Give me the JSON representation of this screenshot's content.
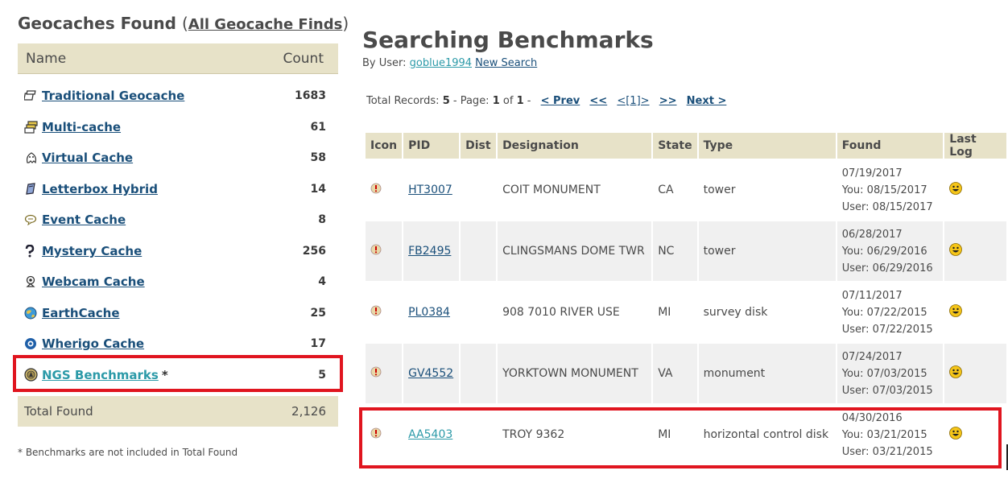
{
  "left": {
    "title": "Geocaches Found",
    "title_link": "All Geocache Finds",
    "header_name": "Name",
    "header_count": "Count",
    "rows": [
      {
        "label": "Traditional Geocache",
        "count": "1683",
        "icon": "traditional-cache-icon"
      },
      {
        "label": "Multi-cache",
        "count": "61",
        "icon": "multi-cache-icon"
      },
      {
        "label": "Virtual Cache",
        "count": "58",
        "icon": "virtual-cache-icon"
      },
      {
        "label": "Letterbox Hybrid",
        "count": "14",
        "icon": "letterbox-icon"
      },
      {
        "label": "Event Cache",
        "count": "8",
        "icon": "event-cache-icon"
      },
      {
        "label": "Mystery Cache",
        "count": "256",
        "icon": "mystery-cache-icon"
      },
      {
        "label": "Webcam Cache",
        "count": "4",
        "icon": "webcam-cache-icon"
      },
      {
        "label": "EarthCache",
        "count": "25",
        "icon": "earthcache-icon"
      },
      {
        "label": "Wherigo Cache",
        "count": "17",
        "icon": "wherigo-cache-icon"
      },
      {
        "label": "NGS Benchmarks",
        "count": "5",
        "icon": "benchmark-icon",
        "suffix": "*"
      }
    ],
    "total_label": "Total Found",
    "total_value": "2,126",
    "footnote": "* Benchmarks are not included in Total Found"
  },
  "right": {
    "title": "Searching Benchmarks",
    "by_user_prefix": "By User:",
    "user": "goblue1994",
    "new_search": "New Search",
    "pager": {
      "total_prefix": "Total Records:",
      "total": "5",
      "page_label": "- Page:",
      "page": "1",
      "of_label": "of",
      "pages": "1",
      "dash": "-",
      "prev": "< Prev",
      "first": "<<",
      "current": "<[1]>",
      "last": ">>",
      "next": "Next >"
    },
    "columns": [
      "Icon",
      "PID",
      "Dist",
      "Designation",
      "State",
      "Type",
      "Found",
      "Last Log"
    ],
    "rows": [
      {
        "pid": "HT3007",
        "dist": "",
        "designation": "COIT MONUMENT",
        "state": "CA",
        "type": "tower",
        "found": "07/19/2017",
        "you": "You: 08/15/2017",
        "user": "User: 08/15/2017"
      },
      {
        "pid": "FB2495",
        "dist": "",
        "designation": "CLINGSMANS DOME TWR",
        "state": "NC",
        "type": "tower",
        "found": "06/28/2017",
        "you": "You: 06/29/2016",
        "user": "User: 06/29/2016"
      },
      {
        "pid": "PL0384",
        "dist": "",
        "designation": "908 7010 RIVER USE",
        "state": "MI",
        "type": "survey disk",
        "found": "07/11/2017",
        "you": "You: 07/22/2015",
        "user": "User: 07/22/2015"
      },
      {
        "pid": "GV4552",
        "dist": "",
        "designation": "YORKTOWN MONUMENT",
        "state": "VA",
        "type": "monument",
        "found": "07/24/2017",
        "you": "You: 07/03/2015",
        "user": "User: 07/03/2015"
      },
      {
        "pid": "AA5403",
        "dist": "",
        "designation": "TROY 9362",
        "state": "MI",
        "type": "horizontal control disk",
        "found": "04/30/2016",
        "you": "You: 03/21/2015",
        "user": "User: 03/21/2015"
      }
    ]
  },
  "colors": {
    "header_bg": "#e7e2c8",
    "link_blue": "#1a4f7a",
    "link_teal": "#2c9aa8",
    "highlight_red": "#e0151f",
    "alt_row": "#f0f0f0"
  }
}
